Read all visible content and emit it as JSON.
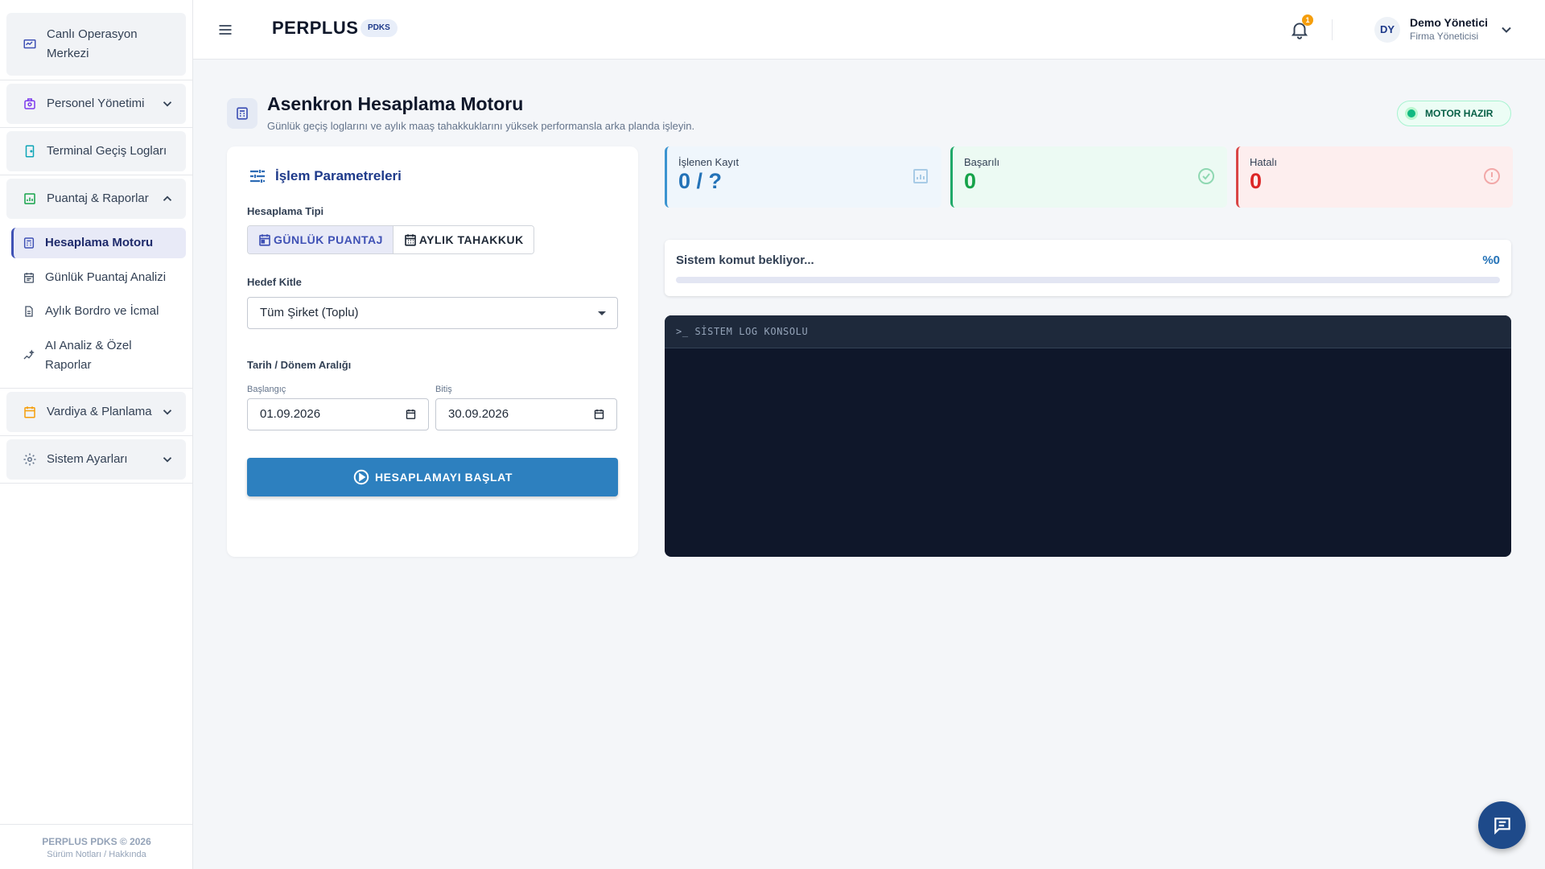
{
  "sidebar": {
    "groups": [
      {
        "label": "Canlı Operasyon Merkezi",
        "icon": "monitor-icon"
      },
      {
        "label": "Personel Yönetimi",
        "icon": "badge-icon"
      },
      {
        "label": "Terminal Geçiş Logları",
        "icon": "door-icon"
      },
      {
        "label": "Puantaj & Raporlar",
        "icon": "report-icon"
      },
      {
        "label": "Vardiya & Planlama",
        "icon": "calendar-icon"
      },
      {
        "label": "Sistem Ayarları",
        "icon": "gear-icon"
      }
    ],
    "sub_items": [
      {
        "label": "Hesaplama Motoru",
        "icon": "calculator-icon",
        "active": true
      },
      {
        "label": "Günlük Puantaj Analizi",
        "icon": "calendar-list-icon"
      },
      {
        "label": "Aylık Bordro ve İcmal",
        "icon": "document-icon"
      },
      {
        "label": "AI Analiz & Özel Raporlar",
        "icon": "sparkle-chart-icon"
      }
    ],
    "footer": {
      "line1": "PERPLUS PDKS © 2026",
      "line2": "Sürüm Notları / Hakkında"
    }
  },
  "topbar": {
    "brand": "PERPLUS",
    "brand_badge": "PDKS",
    "notification_count": "1",
    "user_initials": "DY",
    "user_name": "Demo Yönetici",
    "user_role": "Firma Yöneticisi"
  },
  "page": {
    "title": "Asenkron Hesaplama Motoru",
    "subtitle": "Günlük geçiş loglarını ve aylık maaş tahakkuklarını yüksek performansla arka planda işleyin.",
    "status_badge": "MOTOR HAZIR"
  },
  "params": {
    "title": "İşlem Parametreleri",
    "calc_type_label": "Hesaplama Tipi",
    "calc_types": [
      "GÜNLÜK PUANTAJ",
      "AYLIK TAHAKKUK"
    ],
    "target_label": "Hedef Kitle",
    "target_value": "Tüm Şirket (Toplu)",
    "date_range_label": "Tarih / Dönem Aralığı",
    "start_label": "Başlangıç",
    "start_value": "01.09.2026",
    "end_label": "Bitiş",
    "end_value": "30.09.2026",
    "start_button": "HESAPLAMAYI BAŞLAT"
  },
  "stats": {
    "processed_label": "İşlenen Kayıt",
    "processed_value": "0 / ?",
    "success_label": "Başarılı",
    "success_value": "0",
    "error_label": "Hatalı",
    "error_value": "0"
  },
  "status": {
    "text": "Sistem komut bekliyor...",
    "percent_label": "%0",
    "progress": 0
  },
  "console": {
    "title": ">_ SİSTEM LOG KONSOLU"
  },
  "colors": {
    "primary": "#3f51b5",
    "button": "#2d80bf",
    "success": "#16a34a",
    "error": "#dc2626",
    "console_bg": "#0f172a"
  }
}
